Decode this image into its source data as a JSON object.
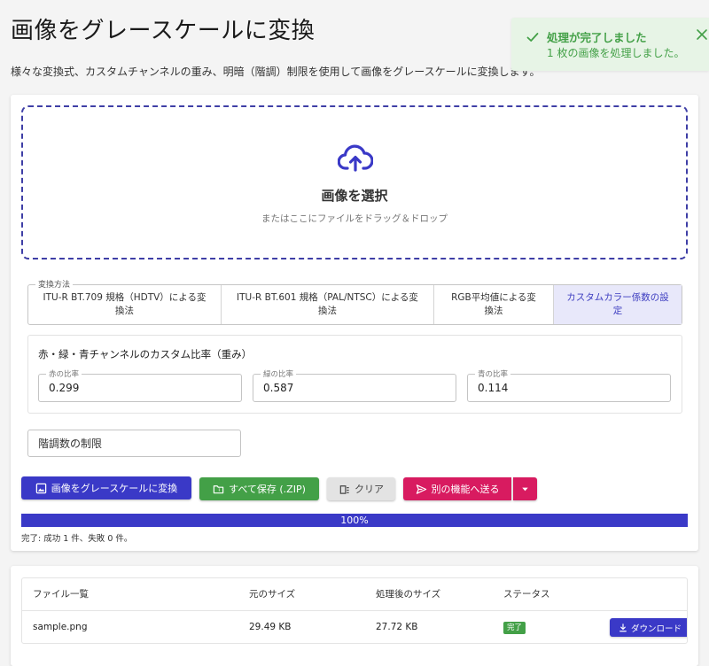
{
  "page": {
    "title": "画像をグレースケールに変換",
    "description": "様々な変換式、カスタムチャンネルの重み、明暗（階調）制限を使用して画像をグレースケールに変換します。"
  },
  "toast": {
    "title": "処理が完了しました",
    "message": "1 枚の画像を処理しました。",
    "color": "#43a047"
  },
  "dropzone": {
    "icon": "cloud-upload-icon",
    "title": "画像を選択",
    "subtitle": "またはここにファイルをドラッグ＆ドロップ"
  },
  "method": {
    "legend": "変換方法",
    "options": [
      {
        "label": "ITU-R BT.709 規格（HDTV）による変換法",
        "selected": false
      },
      {
        "label": "ITU-R BT.601 規格（PAL/NTSC）による変換法",
        "selected": false
      },
      {
        "label": "RGB平均値による変換法",
        "selected": false
      },
      {
        "label": "カスタムカラー係数の設定",
        "selected": true
      }
    ]
  },
  "custom_ratio": {
    "title": "赤・緑・青チャンネルのカスタム比率（重み）",
    "red": {
      "label": "赤の比率",
      "value": "0.299"
    },
    "green": {
      "label": "緑の比率",
      "value": "0.587"
    },
    "blue": {
      "label": "青の比率",
      "value": "0.114"
    }
  },
  "levels": {
    "placeholder": "階調数の制限"
  },
  "actions": {
    "convert_label": "画像をグレースケールに変換",
    "save_all_label": "すべて保存 (.ZIP)",
    "clear_label": "クリア",
    "send_label": "別の機能へ送る"
  },
  "progress": {
    "percent": 100,
    "label": "100%",
    "result_text": "完了: 成功 1 件、失敗 0 件。"
  },
  "table": {
    "headers": [
      "ファイル一覧",
      "元のサイズ",
      "処理後のサイズ",
      "ステータス"
    ],
    "rows": [
      {
        "name": "sample.png",
        "original_size": "29.49 KB",
        "processed_size": "27.72 KB",
        "status": "完了",
        "download_label": "ダウンロード"
      }
    ]
  },
  "colors": {
    "primary": "#3a39c7",
    "success": "#43a047",
    "accent": "#d81b60"
  }
}
